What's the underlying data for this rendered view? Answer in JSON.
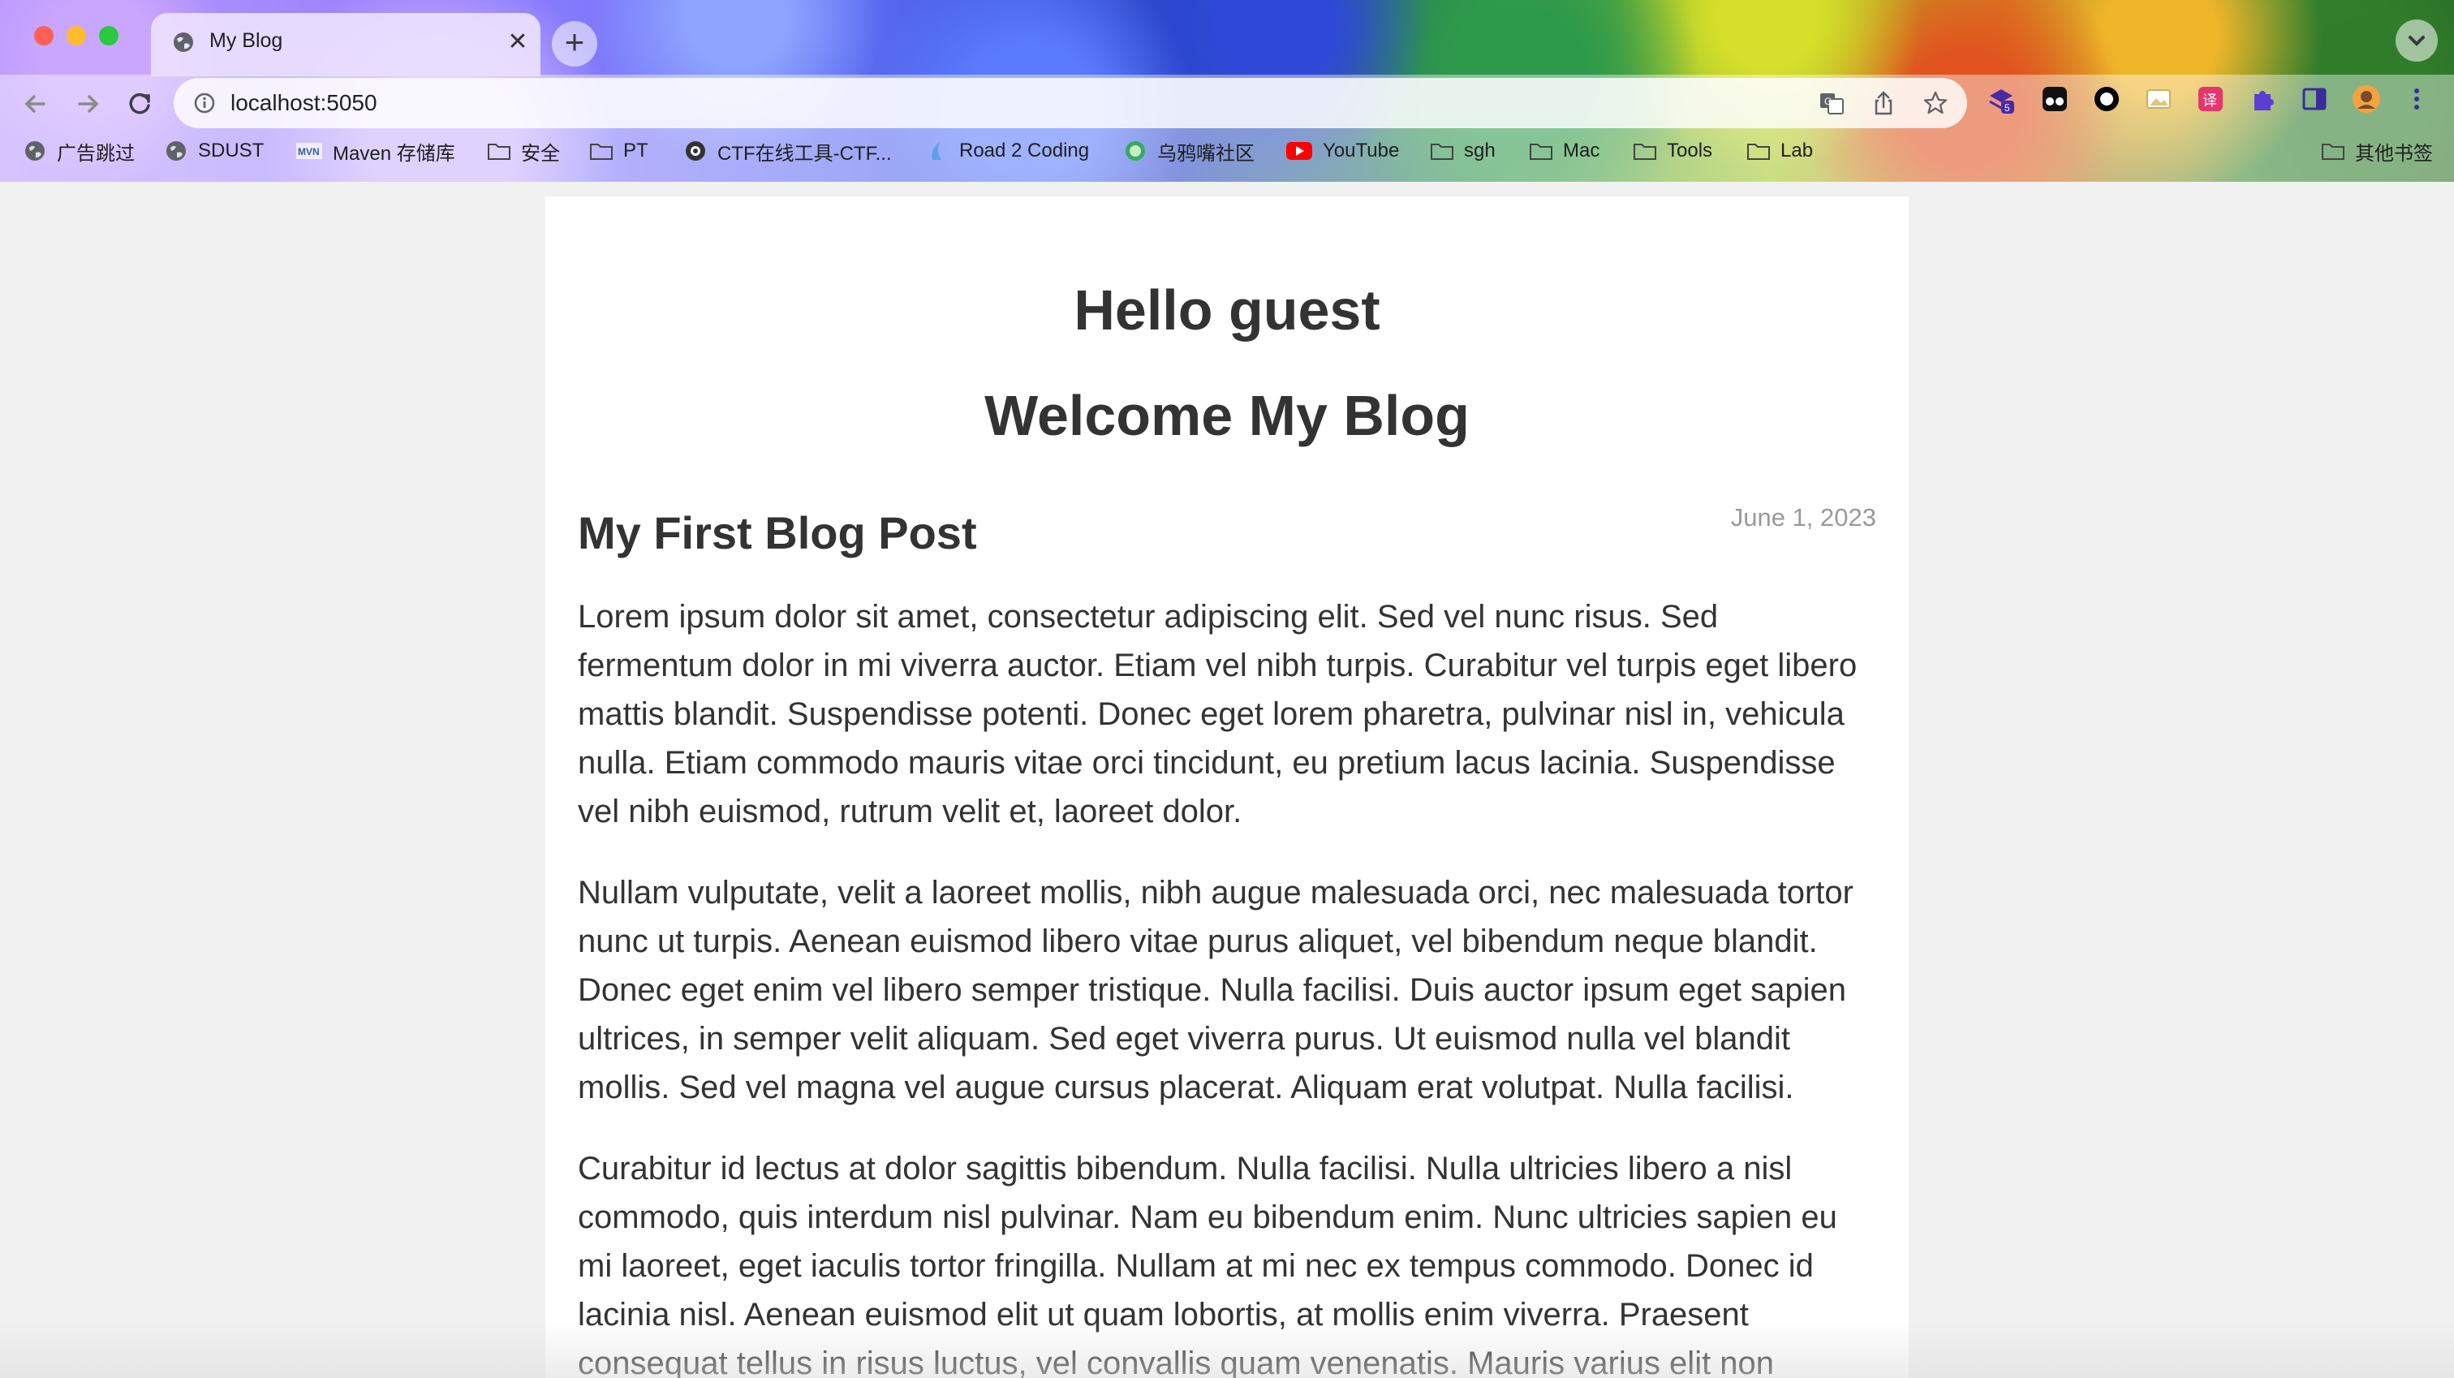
{
  "browser": {
    "tab": {
      "title": "My Blog"
    },
    "new_tab_symbol": "+",
    "address": {
      "url": "localhost:5050"
    },
    "bookmarks": [
      {
        "label": "广告跳过",
        "icon": "globe-icon"
      },
      {
        "label": "SDUST",
        "icon": "globe-icon"
      },
      {
        "label": "Maven 存储库",
        "icon": "mvn-icon"
      },
      {
        "label": "安全",
        "icon": "folder-icon"
      },
      {
        "label": "PT",
        "icon": "folder-icon"
      },
      {
        "label": "CTF在线工具-CTF...",
        "icon": "ctf-icon"
      },
      {
        "label": "Road 2 Coding",
        "icon": "road-icon"
      },
      {
        "label": "乌鸦嘴社区",
        "icon": "crow-icon"
      },
      {
        "label": "YouTube",
        "icon": "youtube-icon"
      },
      {
        "label": "sgh",
        "icon": "folder-icon"
      },
      {
        "label": "Mac",
        "icon": "folder-icon"
      },
      {
        "label": "Tools",
        "icon": "folder-icon"
      },
      {
        "label": "Lab",
        "icon": "folder-icon"
      }
    ],
    "other_bookmarks": "其他书签",
    "extension_badge": "5"
  },
  "page": {
    "greeting": "Hello guest",
    "welcome": "Welcome My Blog",
    "post": {
      "title": "My First Blog Post",
      "date": "June 1, 2023",
      "paragraphs": [
        "Lorem ipsum dolor sit amet, consectetur adipiscing elit. Sed vel nunc risus. Sed fermentum dolor in mi viverra auctor. Etiam vel nibh turpis. Curabitur vel turpis eget libero mattis blandit. Suspendisse potenti. Donec eget lorem pharetra, pulvinar nisl in, vehicula nulla. Etiam commodo mauris vitae orci tincidunt, eu pretium lacus lacinia. Suspendisse vel nibh euismod, rutrum velit et, laoreet dolor.",
        "Nullam vulputate, velit a laoreet mollis, nibh augue malesuada orci, nec malesuada tortor nunc ut turpis. Aenean euismod libero vitae purus aliquet, vel bibendum neque blandit. Donec eget enim vel libero semper tristique. Nulla facilisi. Duis auctor ipsum eget sapien ultrices, in semper velit aliquam. Sed eget viverra purus. Ut euismod nulla vel blandit mollis. Sed vel magna vel augue cursus placerat. Aliquam erat volutpat. Nulla facilisi.",
        "Curabitur id lectus at dolor sagittis bibendum. Nulla facilisi. Nulla ultricies libero a nisl commodo, quis interdum nisl pulvinar. Nam eu bibendum enim. Nunc ultricies sapien eu mi laoreet, eget iaculis tortor fringilla. Nullam at mi nec ex tempus commodo. Donec id lacinia nisl. Aenean euismod elit ut quam lobortis, at mollis enim viverra. Praesent consequat tellus in risus luctus, vel convallis quam venenatis. Mauris varius elit non"
      ]
    }
  },
  "colors": {
    "page_bg": "#f1f1f1",
    "card_bg": "#ffffff",
    "heading": "#333333",
    "date": "#999999"
  }
}
